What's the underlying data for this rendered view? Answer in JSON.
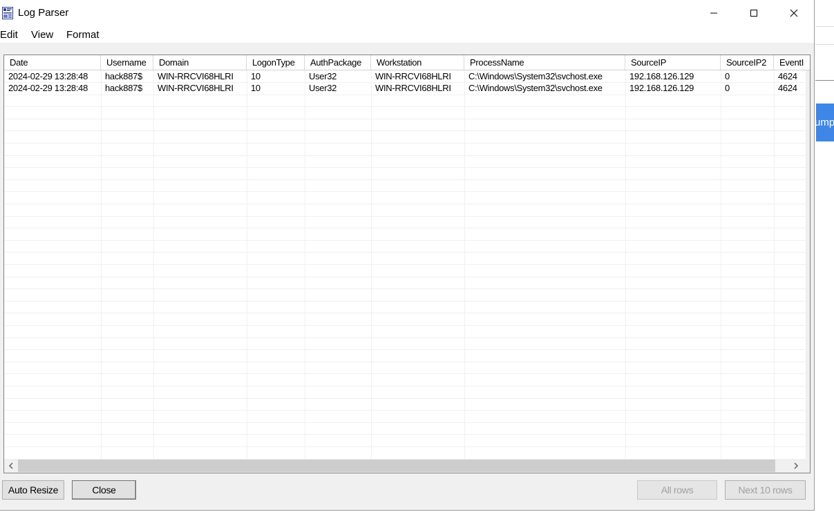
{
  "window": {
    "title": "Log Parser"
  },
  "menu": [
    "Edit",
    "View",
    "Format"
  ],
  "columns": [
    "Date",
    "Username",
    "Domain",
    "LogonType",
    "AuthPackage",
    "Workstation",
    "ProcessName",
    "SourceIP",
    "SourceIP2",
    "EventI"
  ],
  "rows": [
    [
      "2024-02-29 13:28:48",
      "hack887$",
      "WIN-RRCVI68HLRI",
      "10",
      "User32",
      "WIN-RRCVI68HLRI",
      "C:\\Windows\\System32\\svchost.exe",
      "192.168.126.129",
      "0",
      "4624"
    ],
    [
      "2024-02-29 13:28:48",
      "hack887$",
      "WIN-RRCVI68HLRI",
      "10",
      "User32",
      "WIN-RRCVI68HLRI",
      "C:\\Windows\\System32\\svchost.exe",
      "192.168.126.129",
      "0",
      "4624"
    ]
  ],
  "buttons": {
    "auto_resize": "Auto Resize",
    "close": "Close",
    "all_rows": "All rows",
    "next_rows": "Next 10 rows"
  },
  "background_app": {
    "button_fragment": "ump"
  },
  "icons": {
    "minimize": "minimize-icon",
    "maximize": "maximize-icon",
    "close": "close-icon",
    "scroll_left": "chevron-left-icon",
    "scroll_right": "chevron-right-icon"
  },
  "colors": {
    "accent_background_button": "#3f86e6"
  }
}
